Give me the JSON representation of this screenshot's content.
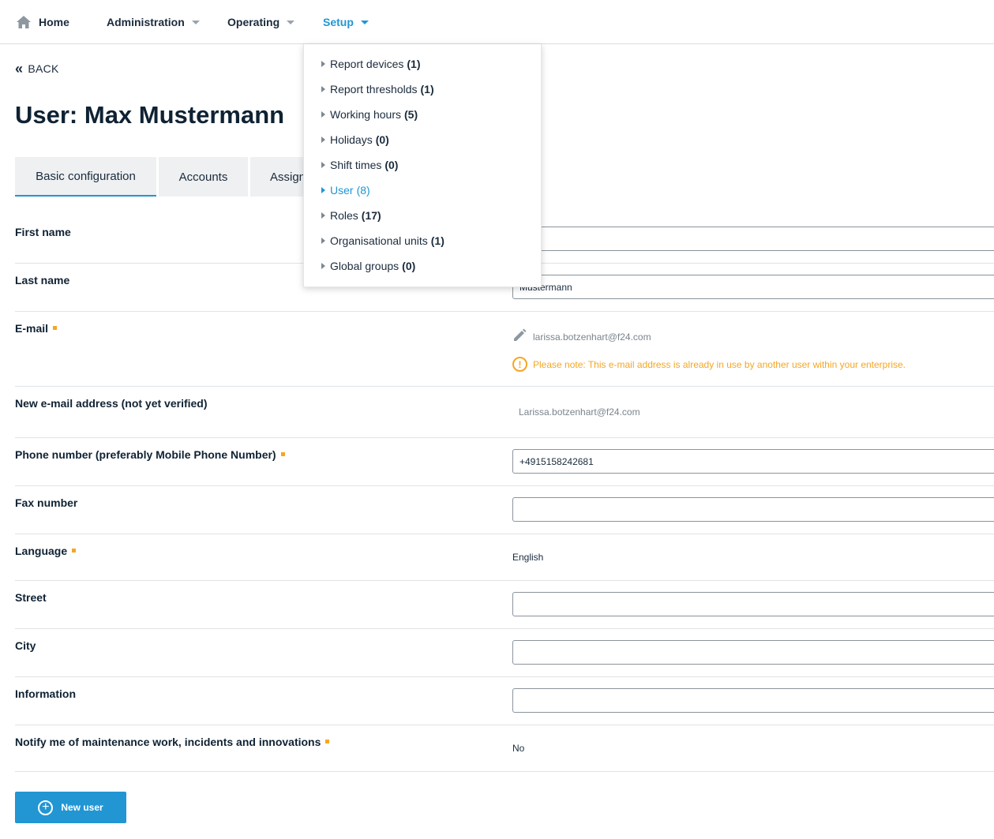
{
  "nav": {
    "home": "Home",
    "administration": "Administration",
    "operating": "Operating",
    "setup": "Setup"
  },
  "setup_menu": [
    {
      "label": "Report devices",
      "count": "(1)"
    },
    {
      "label": "Report thresholds",
      "count": "(1)"
    },
    {
      "label": "Working hours",
      "count": "(5)"
    },
    {
      "label": "Holidays",
      "count": "(0)"
    },
    {
      "label": "Shift times",
      "count": "(0)"
    },
    {
      "label": "User",
      "count": "(8)",
      "active": true
    },
    {
      "label": "Roles",
      "count": "(17)"
    },
    {
      "label": "Organisational units",
      "count": "(1)"
    },
    {
      "label": "Global groups",
      "count": "(0)"
    }
  ],
  "back_label": "BACK",
  "page_title": "User: Max Mustermann",
  "tabs": [
    "Basic configuration",
    "Accounts",
    "Assign"
  ],
  "form": {
    "first_name": {
      "label": "First name",
      "value": ""
    },
    "last_name": {
      "label": "Last name",
      "value": "Mustermann"
    },
    "email": {
      "label": "E-mail",
      "value": "larissa.botzenhart@f24.com",
      "warning": "Please note: This e-mail address is already in use by another user within your enterprise."
    },
    "new_email": {
      "label": "New e-mail address (not yet verified)",
      "value": "Larissa.botzenhart@f24.com"
    },
    "phone": {
      "label": "Phone number (preferably Mobile Phone Number)",
      "value": "+4915158242681"
    },
    "fax": {
      "label": "Fax number",
      "value": ""
    },
    "language": {
      "label": "Language",
      "value": "English"
    },
    "street": {
      "label": "Street",
      "value": ""
    },
    "city": {
      "label": "City",
      "value": ""
    },
    "information": {
      "label": "Information",
      "value": ""
    },
    "notify": {
      "label": "Notify me of maintenance work, incidents and innovations",
      "value": "No"
    }
  },
  "new_user_button": "New user",
  "colors": {
    "accent": "#2196d3",
    "required": "#f5a623",
    "warning": "#f5a623",
    "text": "#1a2b3c"
  }
}
